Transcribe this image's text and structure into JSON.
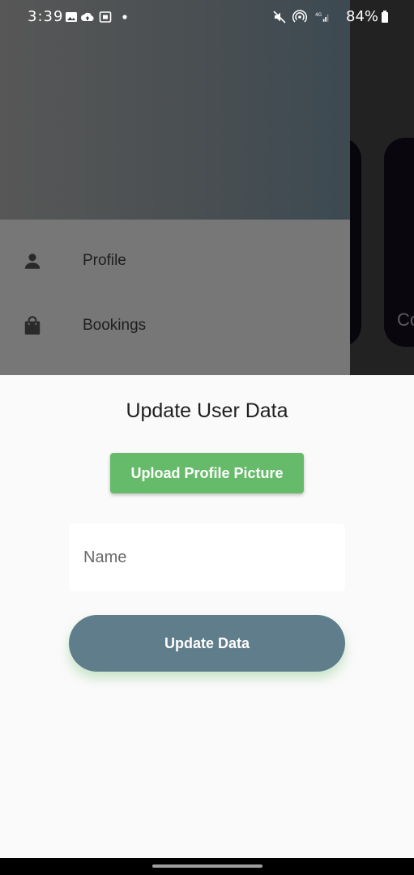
{
  "status_bar": {
    "time": "3:39",
    "battery": "84%",
    "left_icons": [
      "gallery-icon",
      "cloud-upload-icon",
      "cast-icon",
      "dot-icon"
    ],
    "right_icons": [
      "mute-icon",
      "hotspot-icon",
      "4g-signal-icon",
      "battery-icon"
    ]
  },
  "background": {
    "card_label": "Co"
  },
  "drawer": {
    "items": [
      {
        "label": "Profile",
        "icon": "person-icon"
      },
      {
        "label": "Bookings",
        "icon": "shopping-bag-icon"
      }
    ]
  },
  "sheet": {
    "title": "Update User Data",
    "upload_button": "Upload Profile Picture",
    "name_field": {
      "placeholder": "Name",
      "value": ""
    },
    "update_button": "Update Data"
  },
  "colors": {
    "upload_button": "#66bb6a",
    "update_button": "#607d8b",
    "sheet_background": "#fafafa"
  }
}
